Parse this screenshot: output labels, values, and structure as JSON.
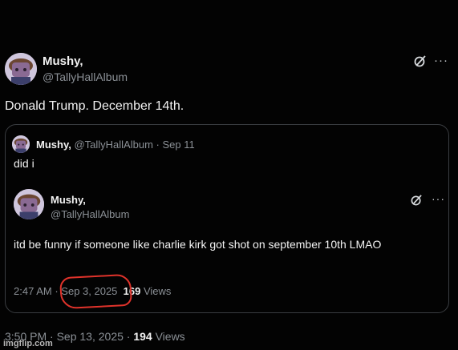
{
  "main_tweet": {
    "author_name": "Mushy,",
    "author_handle": "@TallyHallAlbum",
    "text": "Donald Trump. December 14th.",
    "time": "3:50 PM",
    "date": "Sep 13, 2025",
    "views_count": "194",
    "views_label": "Views",
    "more_label": "···"
  },
  "quoted_tweet": {
    "author_name": "Mushy,",
    "author_handle": "@TallyHallAlbum",
    "date": "Sep 11",
    "text": "did i"
  },
  "inner_tweet": {
    "author_name": "Mushy,",
    "author_handle": "@TallyHallAlbum",
    "text": "itd be funny if someone like charlie kirk got shot on september 10th LMAO",
    "time": "2:47 AM",
    "date": "Sep 3, 2025",
    "views_count": "169",
    "views_label": "Views",
    "more_label": "···"
  },
  "separator": "·",
  "watermark": "imgflip.com",
  "colors": {
    "background": "#030303",
    "text": "#f2f2f2",
    "muted": "#8b9096",
    "border": "#3a3d41",
    "annotation_circle": "#e0332b"
  },
  "icons": [
    "avatar",
    "grok-icon",
    "more-icon"
  ]
}
